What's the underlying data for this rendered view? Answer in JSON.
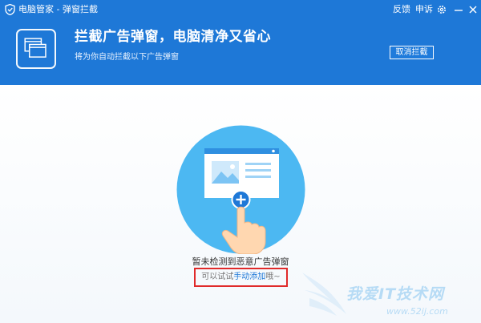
{
  "titlebar": {
    "title": "电脑管家 - 弹窗拦截",
    "feedback": "反馈",
    "appeal": "申诉"
  },
  "header": {
    "headline": "拦截广告弹窗，电脑清净又省心",
    "subline": "将为你自动拦截以下广告弹窗",
    "cancel_button": "取消拦截"
  },
  "main": {
    "status": "暂未检测到恶意广告弹窗",
    "hint_prefix": "可以试试",
    "hint_link": "手动添加",
    "hint_suffix": "哦~"
  },
  "watermark": {
    "title": "我爱IT技术网",
    "url": "www.52ij.com"
  },
  "colors": {
    "brand": "#1e78d7",
    "illustration_circle": "#4cb8f2",
    "highlight_border": "#e02a2a"
  }
}
